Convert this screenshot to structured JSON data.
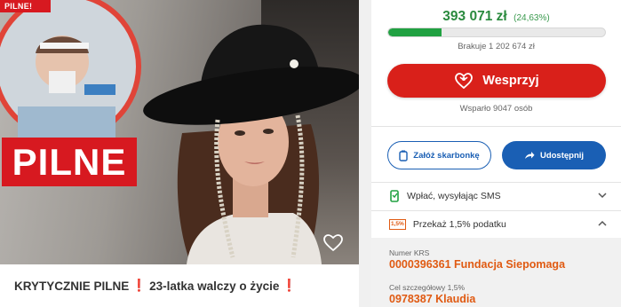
{
  "campaign": {
    "badge": "PILNE!",
    "title_start": "KRYTYCZNIE PILNE",
    "title_mark_1": "❗",
    "title_middle": "23-latka walczy o życie",
    "title_mark_2": "❗",
    "overlay_word": "PILNE"
  },
  "funding": {
    "amount": "393 071 zł",
    "percent": "(24,63%)",
    "progress_fraction": 0.2463,
    "missing": "Brakuje 1 202 674 zł",
    "support_button": "Wesprzyj",
    "supporters": "Wsparło 9047 osób"
  },
  "actions": {
    "piggybank_button": "Załóż skarbonkę",
    "share_button": "Udostępnij"
  },
  "sms": {
    "label": "Wpłać, wysyłając SMS"
  },
  "tax": {
    "label": "Przekaż 1,5% podatku",
    "icon_text": "1,5%",
    "krs_label": "Numer KRS",
    "krs_value": "0000396361 Fundacja Siepomaga",
    "goal_label": "Cel szczegółowy 1,5%",
    "goal_value": "0978387 Klaudia"
  },
  "colors": {
    "brand_red": "#d9201a",
    "progress_green": "#21a142",
    "amount_green": "#2a8a3e",
    "action_blue": "#1a5fb4",
    "tax_orange": "#e05a12"
  },
  "icons": [
    "heart-icon",
    "siepomaga-heart-icon",
    "piggybank-icon",
    "share-arrow-icon",
    "phone-icon",
    "tax-percent-icon",
    "chevron-down-icon",
    "chevron-up-icon"
  ]
}
